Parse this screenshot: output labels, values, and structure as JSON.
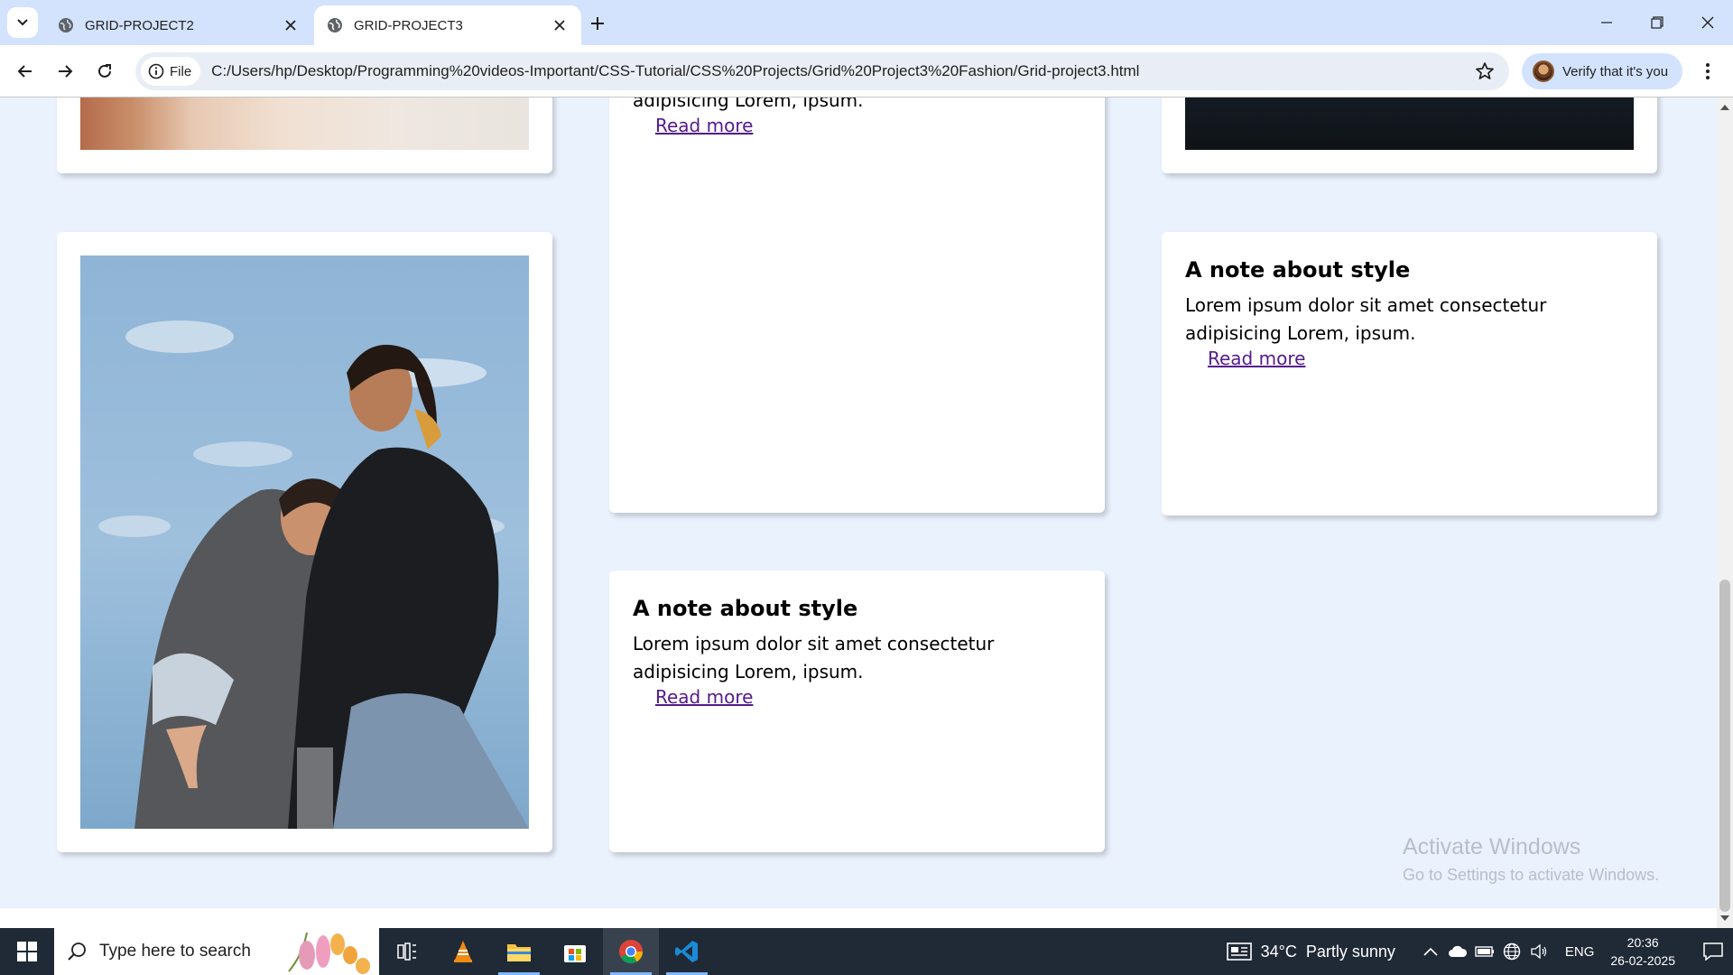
{
  "browser": {
    "tabs": [
      {
        "title": "GRID-PROJECT2",
        "active": false
      },
      {
        "title": "GRID-PROJECT3",
        "active": true
      }
    ],
    "address": {
      "chip_label": "File",
      "url": "C:/Users/hp/Desktop/Programming%20videos-Important/CSS-Tutorial/CSS%20Projects/Grid%20Project3%20Fashion/Grid-project3.html"
    },
    "profile_label": "Verify that it's you"
  },
  "page": {
    "cards": {
      "top_middle": {
        "text_fragment": "adipisicing Lorem, ipsum.",
        "link": "Read more"
      },
      "right_middle": {
        "heading": "A note about style",
        "text": "Lorem ipsum dolor sit amet consectetur adipisicing Lorem, ipsum.",
        "link": "Read more"
      },
      "bottom_middle": {
        "heading": "A note about style",
        "text": "Lorem ipsum dolor sit amet consectetur adipisicing Lorem, ipsum.",
        "link": "Read more"
      }
    },
    "accent_link_color": "#551a8b"
  },
  "watermark": {
    "title": "Activate Windows",
    "subtitle": "Go to Settings to activate Windows."
  },
  "taskbar": {
    "search_placeholder": "Type here to search",
    "apps": [
      "task-view-icon",
      "vlc-icon",
      "file-explorer-icon",
      "microsoft-store-icon",
      "chrome-icon",
      "vscode-icon"
    ],
    "weather": {
      "temp": "34°C",
      "condition": "Partly sunny"
    },
    "language": "ENG",
    "time": "20:36",
    "date": "26-02-2025"
  }
}
